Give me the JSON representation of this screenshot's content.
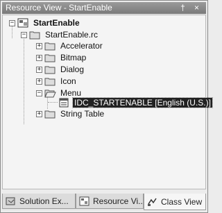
{
  "window": {
    "title": "Resource View - StartEnable",
    "pin_glyph": "†",
    "close_glyph": "×"
  },
  "tree": {
    "root": {
      "label": "StartEnable",
      "expander": "−"
    },
    "rc": {
      "label": "StartEnable.rc",
      "expander": "−"
    },
    "items": [
      {
        "label": "Accelerator",
        "expander": "+"
      },
      {
        "label": "Bitmap",
        "expander": "+"
      },
      {
        "label": "Dialog",
        "expander": "+"
      },
      {
        "label": "Icon",
        "expander": "+"
      },
      {
        "label": "Menu",
        "expander": "−"
      },
      {
        "label": "IDC_STARTENABLE [English (U.S.)]",
        "selected": true
      },
      {
        "label": "String Table",
        "expander": "+"
      }
    ]
  },
  "tabs": [
    {
      "label": "Solution Ex...",
      "icon": "solution-explorer-icon"
    },
    {
      "label": "Resource Vi...",
      "icon": "resource-view-icon"
    },
    {
      "label": "Class View",
      "icon": "class-view-icon",
      "active": true
    }
  ]
}
